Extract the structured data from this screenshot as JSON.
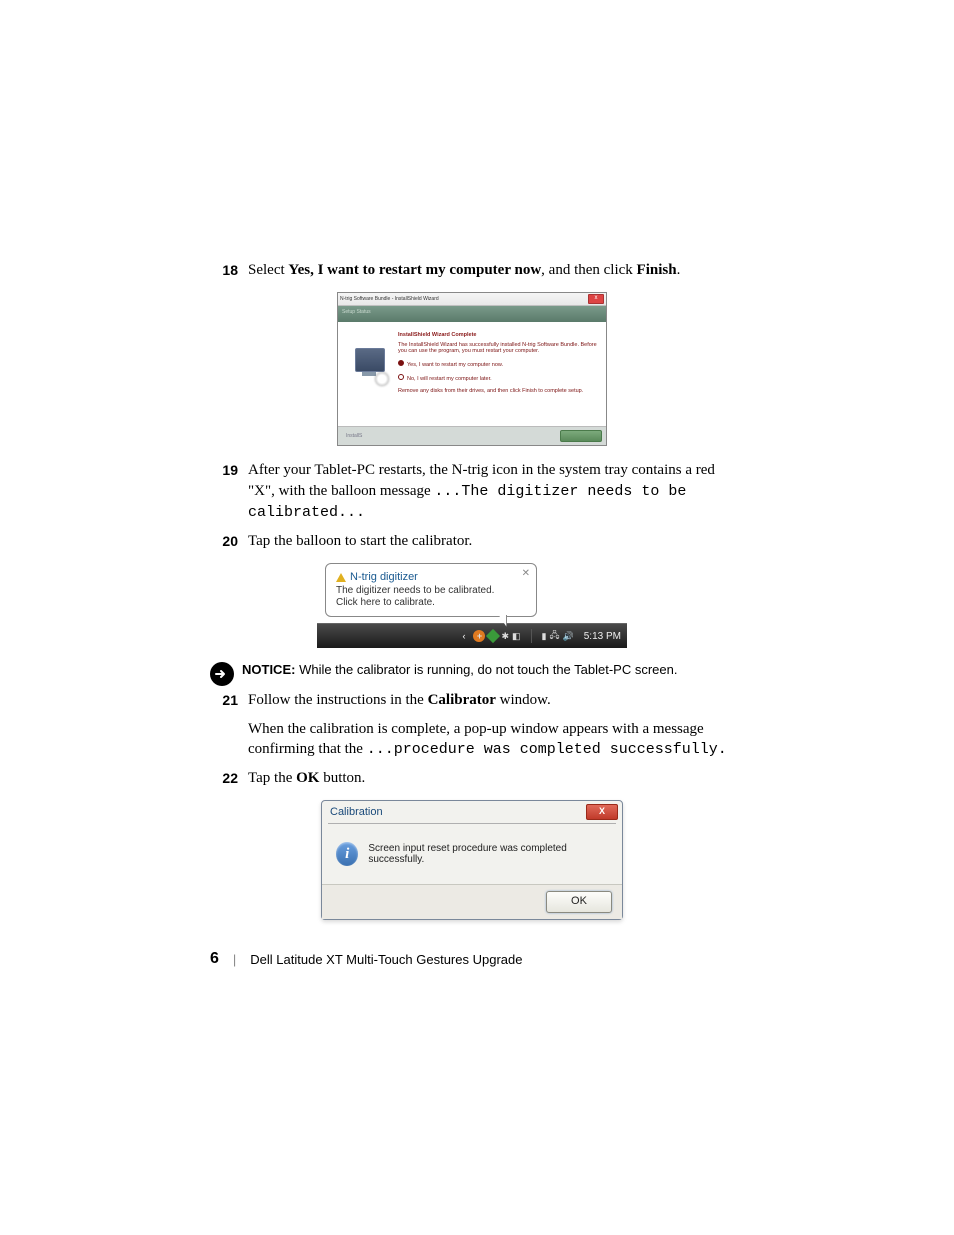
{
  "steps": {
    "s18": {
      "num": "18",
      "pre": "Select ",
      "bold1": "Yes, I want to restart my computer now",
      "mid": ", and then click ",
      "bold2": "Finish",
      "post": "."
    },
    "s19": {
      "num": "19",
      "pre": "After your Tablet-PC restarts, the N-trig icon in the system tray contains a red \"X\", with the balloon message ",
      "mono": "...The digitizer needs to be calibrated..."
    },
    "s20": {
      "num": "20",
      "text": "Tap the balloon to start the calibrator."
    },
    "s21": {
      "num": "21",
      "pre": "Follow the instructions in the ",
      "bold1": "Calibrator",
      "post": " window."
    },
    "s21b": {
      "pre": "When the calibration is complete, a pop-up window appears with a message confirming that the ",
      "mono": "...procedure was completed successfully."
    },
    "s22": {
      "num": "22",
      "pre": "Tap the ",
      "bold1": "OK",
      "post": " button."
    }
  },
  "wizard": {
    "title": "N-trig Software Bundle - InstallShield Wizard",
    "banner": "Setup Status",
    "heading": "InstallShield Wizard Complete",
    "line1": "The InstallShield Wizard has successfully installed N-trig Software Bundle. Before you can use the program, you must restart your computer.",
    "radio1": "Yes, I want to restart my computer now.",
    "radio2": "No, I will restart my computer later.",
    "line2": "Remove any disks from their drives, and then click Finish to complete setup.",
    "footer_left": "InstallS"
  },
  "balloon": {
    "title": "N-trig digitizer",
    "line1": "The digitizer needs to be calibrated.",
    "line2": "Click here to calibrate.",
    "time": "5:13 PM"
  },
  "notice": {
    "label": "NOTICE:",
    "text": " While the calibrator is running, do not touch the Tablet-PC screen."
  },
  "calib": {
    "title": "Calibration",
    "msg": "Screen input reset procedure was completed successfully.",
    "ok": "OK"
  },
  "footer": {
    "page": "6",
    "sep": "|",
    "title": "Dell Latitude XT Multi-Touch Gestures Upgrade"
  }
}
